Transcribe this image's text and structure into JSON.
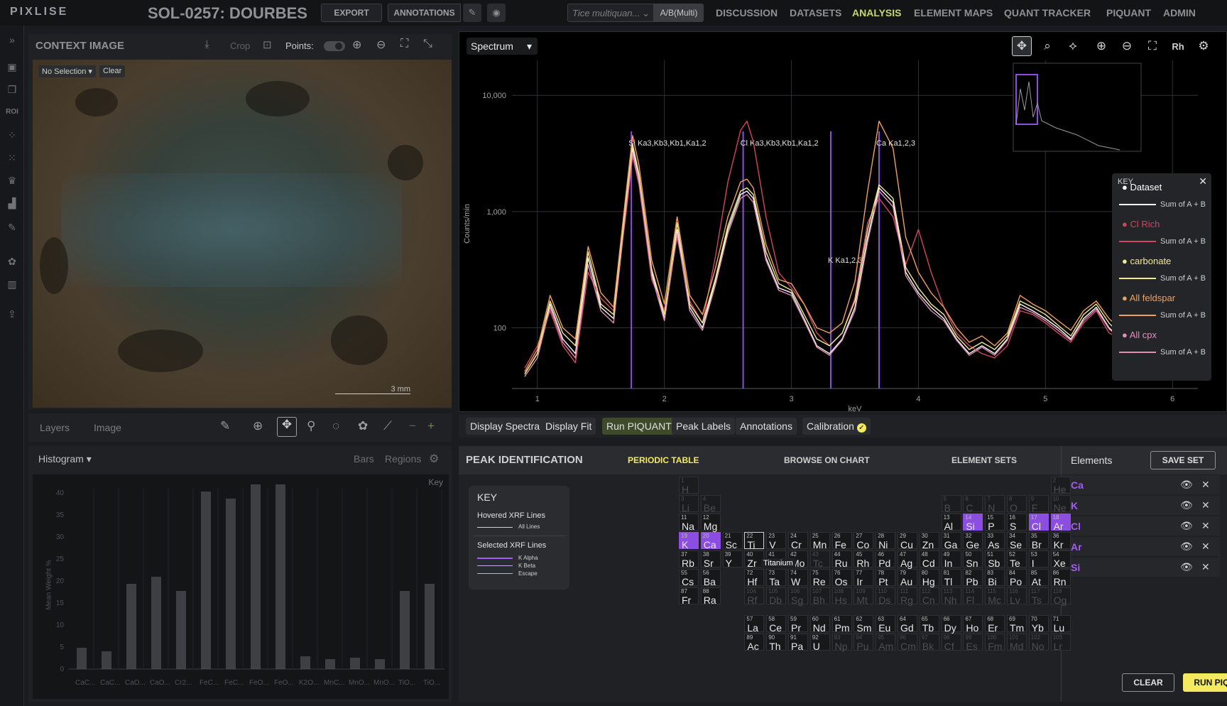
{
  "app": {
    "logo": "PIXLISE",
    "title": "SOL-0257: DOURBES"
  },
  "topbar": {
    "export_label": "EXPORT",
    "annotations_label": "ANNOTATIONS",
    "quant_placeholder": "Tice multiquan...",
    "ab_multi_label": "A/B(Multi)",
    "nav": [
      "DISCUSSION",
      "DATASETS",
      "ANALYSIS",
      "ELEMENT MAPS",
      "QUANT TRACKER",
      "PIQUANT",
      "ADMIN"
    ],
    "active_nav": "ANALYSIS"
  },
  "rail": {
    "roi_label": "ROI"
  },
  "context": {
    "title": "CONTEXT IMAGE",
    "crop_label": "Crop",
    "points_label": "Points:",
    "selection_label": "No Selection",
    "clear_label": "Clear",
    "scale_label": "3 mm",
    "tab_layers": "Layers",
    "tab_image": "Image"
  },
  "histogram": {
    "title": "Histogram",
    "bars_label": "Bars",
    "regions_label": "Regions",
    "key_label": "Key",
    "ylabel": "Mean Weight %",
    "yticks": [
      "40",
      "35",
      "30",
      "25",
      "20",
      "15",
      "10",
      "5",
      "0"
    ],
    "categories": [
      "CaC...",
      "CaC...",
      "CaO...",
      "CaO...",
      "Cr2...",
      "FeC...",
      "FeC...",
      "FeO...",
      "FeO...",
      "K2O...",
      "MnC...",
      "MnO...",
      "MnO...",
      "TiO...",
      "TiO..."
    ]
  },
  "spectrum": {
    "mode_label": "Spectrum",
    "rh_label": "Rh",
    "key_title": "KEY",
    "key_items": [
      {
        "name": "Dataset",
        "sub": "Sum of A + B",
        "color": "#ffffff"
      },
      {
        "name": "Cl Rich",
        "sub": "Sum of A + B",
        "color": "#d0465e"
      },
      {
        "name": "carbonate",
        "sub": "Sum of A + B",
        "color": "#f2ea8e"
      },
      {
        "name": "All feldspar",
        "sub": "Sum of A + B",
        "color": "#f0a060"
      },
      {
        "name": "All cpx",
        "sub": "Sum of A + B",
        "color": "#e28fb8"
      }
    ]
  },
  "chart_data": {
    "type": "line",
    "xlabel": "keV",
    "ylabel": "Counts/min",
    "log_y": true,
    "xlim": [
      0.8,
      6.2
    ],
    "ylim": [
      30,
      20000
    ],
    "x_ticks": [
      "1",
      "2",
      "3",
      "4",
      "5",
      "6"
    ],
    "y_ticks": [
      "10,000",
      "1,000",
      "100"
    ],
    "annotations": [
      {
        "element": "Si",
        "lines": "Ka3,Kb3,Kb1,Ka1,2",
        "x": 1.74
      },
      {
        "element": "Cl",
        "lines": "Ka3,Kb3,Kb1,Ka1,2",
        "x": 2.62
      },
      {
        "element": "Ca",
        "lines": "Ka1,2,3",
        "x": 3.69
      },
      {
        "element": "K",
        "lines": "Ka1,2,3",
        "x": 3.31
      }
    ],
    "x": [
      0.9,
      1.0,
      1.1,
      1.2,
      1.3,
      1.4,
      1.5,
      1.6,
      1.7,
      1.75,
      1.8,
      1.9,
      2.0,
      2.1,
      2.2,
      2.3,
      2.4,
      2.5,
      2.6,
      2.65,
      2.7,
      2.8,
      2.9,
      3.0,
      3.1,
      3.2,
      3.3,
      3.4,
      3.5,
      3.6,
      3.69,
      3.8,
      3.9,
      4.0,
      4.1,
      4.2,
      4.3,
      4.4,
      4.5,
      4.6,
      4.7,
      4.8,
      4.9,
      5.0,
      5.1,
      5.2,
      5.3,
      5.4,
      5.5,
      5.6,
      5.7,
      5.8,
      5.9,
      6.0
    ],
    "series": [
      {
        "name": "Dataset",
        "color": "#ffffff",
        "values": [
          40,
          60,
          160,
          80,
          60,
          400,
          150,
          120,
          1200,
          3500,
          2000,
          300,
          120,
          700,
          150,
          100,
          250,
          700,
          1400,
          1500,
          1300,
          400,
          220,
          200,
          120,
          70,
          60,
          80,
          150,
          600,
          1600,
          1200,
          300,
          200,
          150,
          120,
          80,
          60,
          70,
          60,
          80,
          160,
          140,
          120,
          100,
          80,
          120,
          150,
          100,
          80,
          90,
          150,
          200,
          250
        ]
      },
      {
        "name": "Cl Rich",
        "color": "#d0465e",
        "values": [
          45,
          70,
          140,
          70,
          50,
          300,
          180,
          140,
          1000,
          3000,
          1700,
          260,
          140,
          600,
          170,
          110,
          400,
          1800,
          5000,
          6000,
          4000,
          900,
          300,
          220,
          160,
          90,
          70,
          90,
          180,
          800,
          1300,
          900,
          350,
          700,
          300,
          150,
          90,
          70,
          60,
          55,
          70,
          140,
          130,
          110,
          90,
          75,
          110,
          140,
          90,
          80,
          90,
          140,
          190,
          230
        ]
      },
      {
        "name": "carbonate",
        "color": "#f2ea8e",
        "values": [
          40,
          60,
          170,
          90,
          70,
          450,
          160,
          130,
          1300,
          3800,
          2100,
          320,
          130,
          800,
          160,
          110,
          260,
          750,
          1500,
          1600,
          1400,
          450,
          240,
          210,
          130,
          80,
          70,
          90,
          170,
          700,
          1700,
          1300,
          330,
          220,
          160,
          130,
          85,
          65,
          75,
          65,
          85,
          170,
          150,
          130,
          105,
          85,
          130,
          160,
          110,
          85,
          95,
          160,
          210,
          260
        ]
      },
      {
        "name": "All feldspar",
        "color": "#f0a060",
        "values": [
          42,
          65,
          190,
          100,
          80,
          500,
          200,
          150,
          1500,
          4500,
          2500,
          380,
          160,
          900,
          190,
          130,
          320,
          900,
          1800,
          1900,
          1600,
          520,
          260,
          240,
          160,
          100,
          90,
          110,
          250,
          1500,
          6000,
          3500,
          600,
          300,
          200,
          150,
          100,
          75,
          85,
          70,
          90,
          190,
          160,
          140,
          115,
          95,
          140,
          170,
          120,
          95,
          105,
          170,
          230,
          280
        ]
      },
      {
        "name": "All cpx",
        "color": "#e28fb8",
        "values": [
          38,
          55,
          150,
          75,
          55,
          350,
          140,
          110,
          1100,
          3200,
          1800,
          280,
          115,
          650,
          140,
          95,
          230,
          650,
          1300,
          1400,
          1200,
          380,
          210,
          190,
          115,
          68,
          58,
          78,
          140,
          550,
          1500,
          1100,
          280,
          190,
          140,
          115,
          78,
          58,
          68,
          58,
          78,
          150,
          135,
          115,
          95,
          78,
          115,
          145,
          98,
          78,
          88,
          145,
          195,
          245
        ]
      }
    ]
  },
  "tabs": [
    "Display Spectra",
    "Display Fit",
    "Run PIQUANT",
    "Peak Labels",
    "Annotations",
    "Calibration"
  ],
  "active_tab": "Run PIQUANT",
  "peak": {
    "title": "PEAK IDENTIFICATION",
    "tab_periodic": "PERIODIC TABLE",
    "tab_browse": "BROWSE ON CHART",
    "tab_sets": "ELEMENT SETS",
    "key_title": "KEY",
    "key_hovered": "Hovered XRF Lines",
    "key_all_lines": "All Lines",
    "key_selected": "Selected XRF Lines",
    "key_kalpha": "K Alpha",
    "key_kbeta": "K Beta",
    "key_escape": "Escape",
    "hover_tooltip": "Titanium",
    "elements_title": "Elements",
    "save_set_label": "SAVE SET",
    "selected_elements": [
      "Ca",
      "K",
      "Cl",
      "Ar",
      "Si"
    ],
    "clear_label": "CLEAR",
    "run_label": "RUN PIQUANT"
  },
  "colors": {
    "accent": "#c7d86a",
    "selected": "#8c4ee0",
    "run_button": "#f3ea5f"
  }
}
